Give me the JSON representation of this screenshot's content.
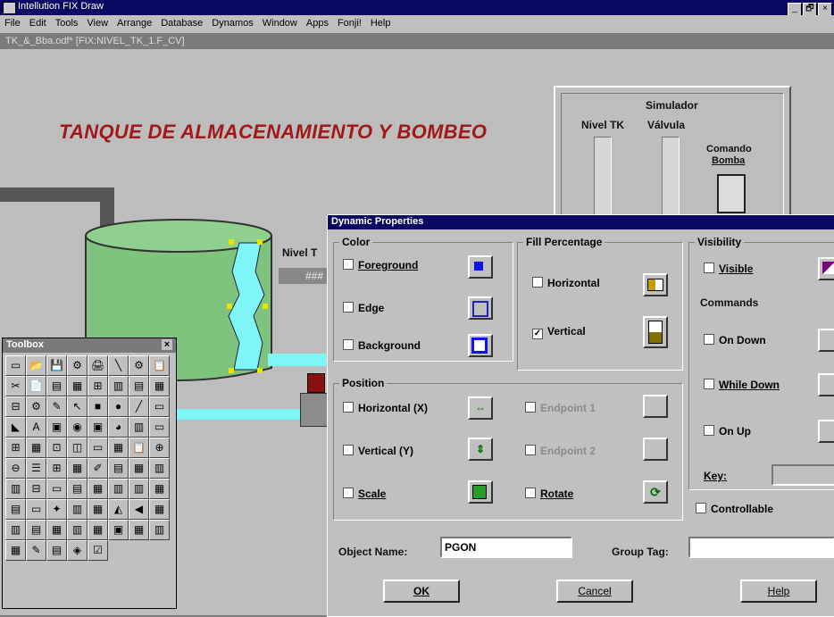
{
  "app": {
    "title": "Intellution FIX Draw"
  },
  "window_buttons": [
    "_",
    "🗗",
    "×"
  ],
  "menu": [
    "File",
    "Edit",
    "Tools",
    "View",
    "Arrange",
    "Database",
    "Dynamos",
    "Window",
    "Apps",
    "Fonji!",
    "Help"
  ],
  "document": {
    "title": "TK_&_Bba.odf*  [FIX:NIVEL_TK_1.F_CV]"
  },
  "canvas": {
    "heading": "TANQUE DE ALMACENAMIENTO Y BOMBEO",
    "nivel_label": "Nivel T",
    "nivel_value": "###",
    "simulator": {
      "title": "Simulador",
      "nivel": "Nivel TK",
      "valvula": "Válvula",
      "comando_1": "Comando",
      "comando_2": "Bomba"
    },
    "colors": {
      "tank": "#7ec47e",
      "water": "#7ff6f6",
      "pipe_top": "#5d5d5d",
      "pipe_liquid": "#7ff6f6",
      "heading": "#a01818"
    }
  },
  "toolbox": {
    "title": "Toolbox",
    "close": "×",
    "tools": [
      "▭",
      "📂",
      "💾",
      "⚙",
      "🖨",
      "╲",
      "⚙",
      "📋",
      "✂",
      "📄",
      "▤",
      "▦",
      "⊞",
      "▥",
      "▤",
      "▦",
      "⊟",
      "⚙",
      "✎",
      "↖",
      "■",
      "●",
      "╱",
      "▭",
      "◣",
      "A",
      "▣",
      "◉",
      "▣",
      "◕",
      "▥",
      "▭",
      "⊞",
      "▦",
      "⊡",
      "◫",
      "▭",
      "▦",
      "📋",
      "⊕",
      "⊖",
      "☰",
      "⊞",
      "▦",
      "✐",
      "▤",
      "▦",
      "▥",
      "▥",
      "⊟",
      "▭",
      "▤",
      "▦",
      "▥",
      "▥",
      "▦",
      "▤",
      "▭",
      "✦",
      "▥",
      "▦",
      "◭",
      "◀",
      "▦",
      "▥",
      "▤",
      "▦",
      "▥",
      "▦",
      "▣",
      "▦",
      "▥",
      "▦",
      "✎",
      "▤",
      "◈",
      "☑"
    ]
  },
  "dialog": {
    "title": "Dynamic Properties",
    "color": {
      "title": "Color",
      "foreground": "Foreground",
      "edge": "Edge",
      "background": "Background"
    },
    "fill": {
      "title": "Fill Percentage",
      "horizontal": "Horizontal",
      "vertical": "Vertical"
    },
    "visibility": {
      "title": "Visibility",
      "visible": "Visible"
    },
    "commands": {
      "title": "Commands",
      "on_down": "On Down",
      "while_down": "While Down",
      "on_up": "On Up",
      "key": "Key:",
      "controllable": "Controllable"
    },
    "position": {
      "title": "Position",
      "horizontal": "Horizontal (X)",
      "vertical": "Vertical (Y)",
      "scale": "Scale",
      "endpoint1": "Endpoint 1",
      "endpoint2": "Endpoint 2",
      "rotate": "Rotate"
    },
    "object_name_label": "Object Name:",
    "object_name": "PGON",
    "group_tag_label": "Group Tag:",
    "group_tag": "",
    "ok": "OK",
    "cancel": "Cancel",
    "help": "Help",
    "vertical_checked": "✓"
  }
}
